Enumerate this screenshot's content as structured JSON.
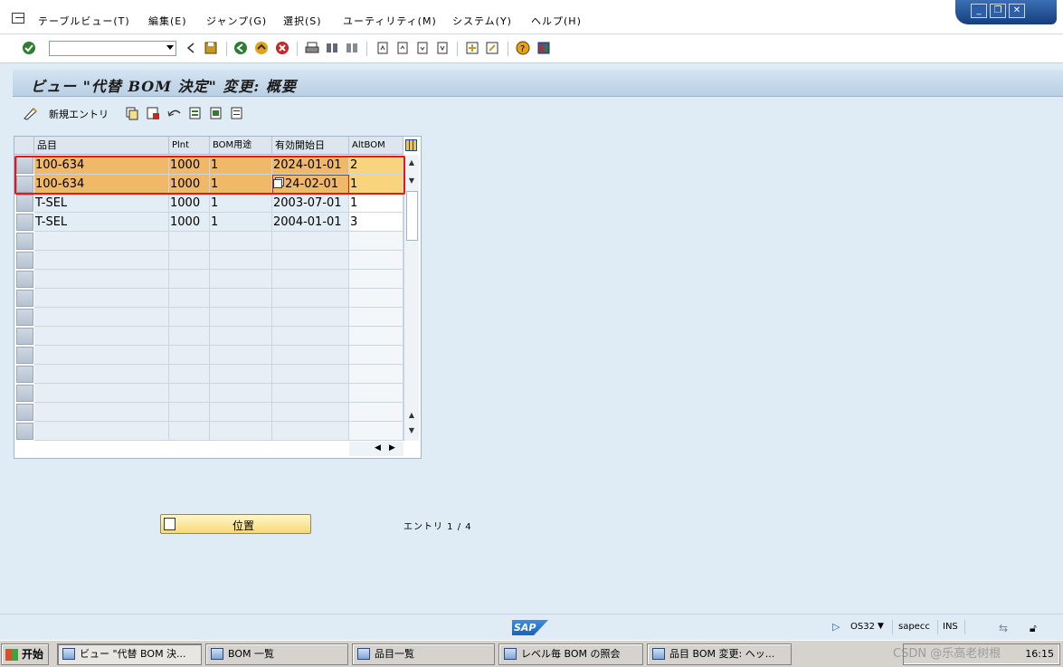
{
  "menubar": {
    "items": [
      "テーブルビュー(T)",
      "編集(E)",
      "ジャンプ(G)",
      "選択(S)",
      "ユーティリティ(M)",
      "システム(Y)",
      "ヘルプ(H)"
    ]
  },
  "title": "ビュー \"代替 BOM 決定\" 変更: 概要",
  "app_toolbar": {
    "new_entry_label": "新規エントリ"
  },
  "table": {
    "columns": [
      "品目",
      "Plnt",
      "BOM用途",
      "有効開始日",
      "AltBOM"
    ],
    "rows": [
      {
        "material": "100-634",
        "plant": "1000",
        "usage": "1",
        "valid_from": "2024-01-01",
        "alt_bom": "2",
        "highlighted": true
      },
      {
        "material": "100-634",
        "plant": "1000",
        "usage": "1",
        "valid_from": "24-02-01",
        "alt_bom": "1",
        "highlighted": true
      },
      {
        "material": "T-SEL",
        "plant": "1000",
        "usage": "1",
        "valid_from": "2003-07-01",
        "alt_bom": "1",
        "highlighted": false
      },
      {
        "material": "T-SEL",
        "plant": "1000",
        "usage": "1",
        "valid_from": "2004-01-01",
        "alt_bom": "3",
        "highlighted": false
      }
    ],
    "empty_rows": 11
  },
  "position_button": {
    "label": "位置"
  },
  "entry_count": "エントリ 1 / 4",
  "statusbar": {
    "logo": "SAP",
    "transaction": "OS32",
    "server": "sapecc",
    "mode": "INS"
  },
  "taskbar": {
    "start_label": "开始",
    "tasks": [
      "ビュー \"代替 BOM 決...",
      "BOM 一覧",
      "品目一覧",
      "レベル毎 BOM の照会",
      "品目 BOM 変更: ヘッ..."
    ],
    "active_index": 0,
    "watermark": "CSDN @乐高老树根",
    "clock": "16:15"
  },
  "colors": {
    "highlight_row": "#f0b96a",
    "highlight_alt": "#f9d47e",
    "red_box": "#e8161b",
    "background": "#dfebf5"
  }
}
